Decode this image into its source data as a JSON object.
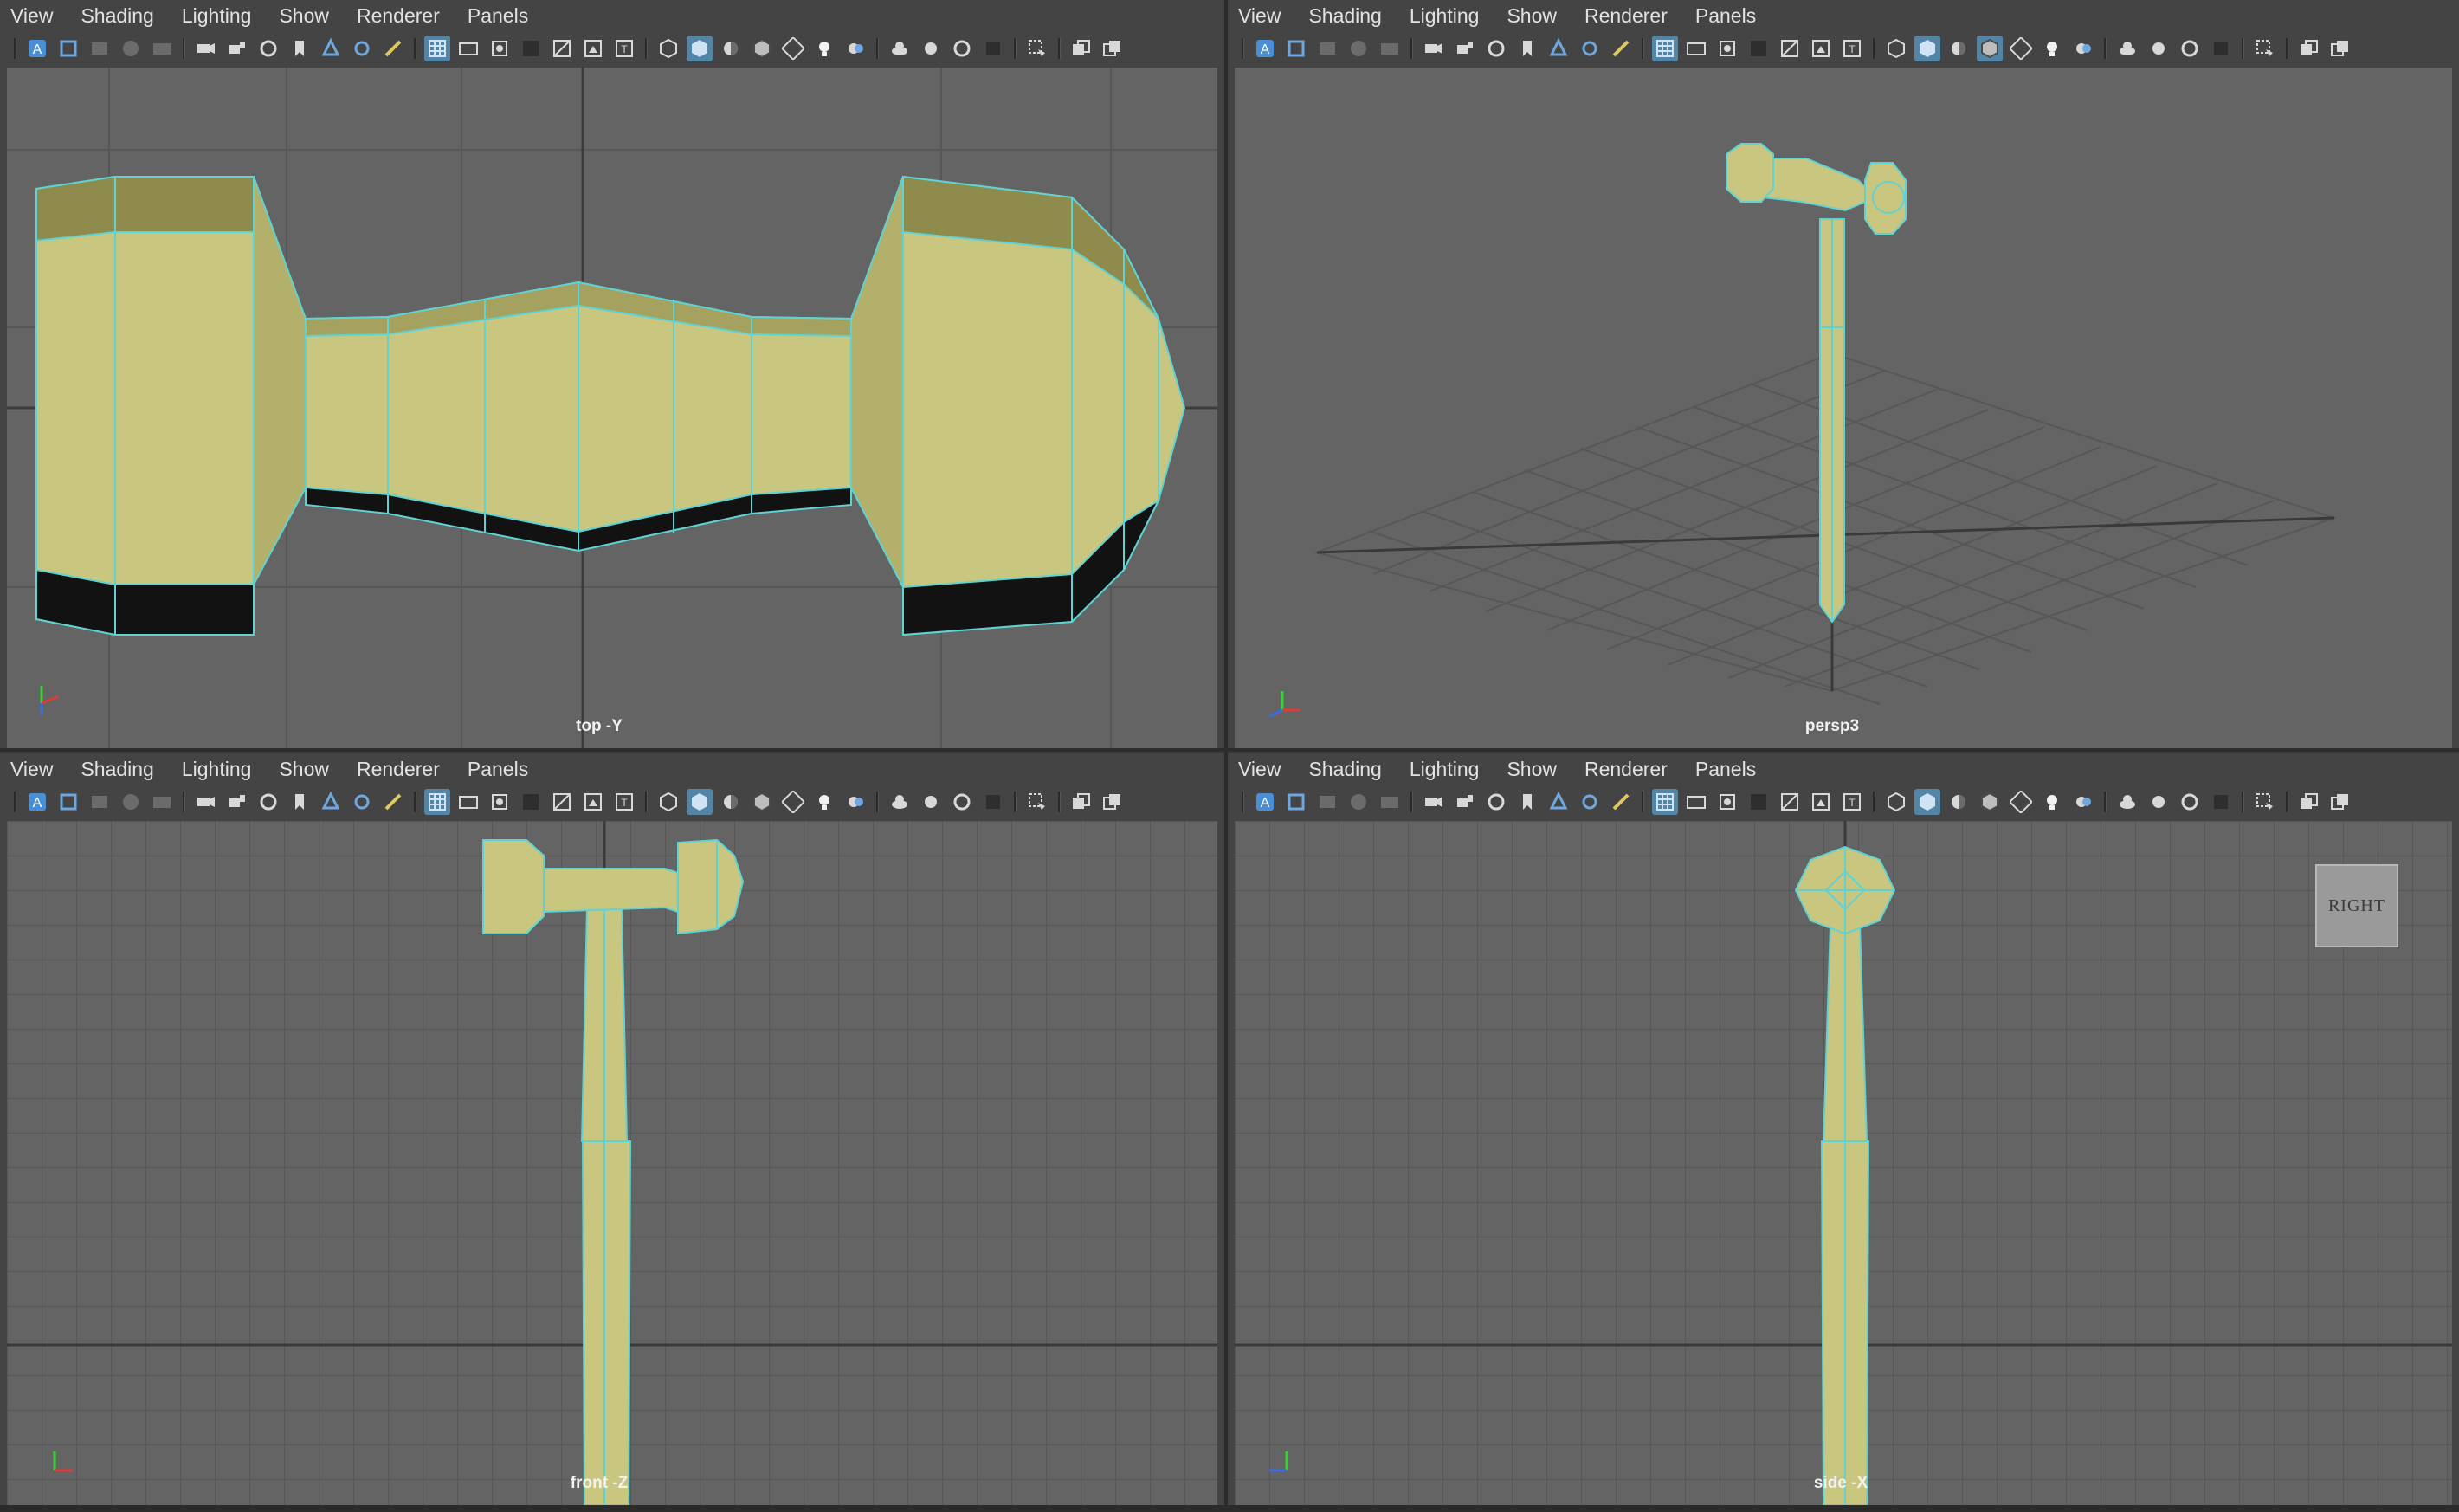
{
  "menu": [
    "View",
    "Shading",
    "Lighting",
    "Show",
    "Renderer",
    "Panels"
  ],
  "toolbar_icons": [
    "select-camera-icon",
    "frame-icon",
    "grid-view-icon",
    "sphere-icon",
    "film-gate-icon",
    "camera-icon",
    "camera-lock-icon",
    "camera-bookmark-icon",
    "bookmark-icon",
    "image-plane-icon",
    "move-icon",
    "paint-icon",
    "grid-icon",
    "film-icon",
    "resolution-gate-icon",
    "gate-mask-icon",
    "field-chart-icon",
    "safe-action-icon",
    "safe-title-icon",
    "wireframe-cube-icon",
    "smooth-shaded-cube-icon",
    "flat-shaded-icon",
    "wireframe-on-shaded-icon",
    "checker-icon",
    "light-bulb-icon",
    "shadow-icon",
    "ambient-occlusion-icon",
    "motion-blur-icon",
    "anti-alias-icon",
    "depth-icon",
    "isolate-select-icon",
    "xray-icon",
    "xray-joints-icon"
  ],
  "viewports": [
    {
      "id": "top",
      "label": "top -Y",
      "axes": [
        "y",
        "x",
        "z"
      ],
      "active_icons": [
        "grid-icon",
        "smooth-shaded-cube-icon"
      ]
    },
    {
      "id": "persp",
      "label": "persp3",
      "axes": [
        "y",
        "x",
        "z"
      ],
      "active_icons": [
        "grid-icon",
        "smooth-shaded-cube-icon",
        "wireframe-on-shaded-icon"
      ]
    },
    {
      "id": "front",
      "label": "front -Z",
      "axes": [
        "y",
        "x",
        "z"
      ],
      "active_icons": [
        "grid-icon",
        "smooth-shaded-cube-icon"
      ]
    },
    {
      "id": "side",
      "label": "side -X",
      "axes": [
        "y",
        "x",
        "z"
      ],
      "active_icons": [
        "grid-icon",
        "smooth-shaded-cube-icon"
      ]
    }
  ],
  "viewcube_label": "RIGHT",
  "colors": {
    "background": "#646464",
    "panel": "#444444",
    "grid": "#555555",
    "grid_axis": "#3a3a3a",
    "mesh_fill": "#c9c680",
    "mesh_wire": "#5fd3d3",
    "accent": "#5285a6"
  }
}
